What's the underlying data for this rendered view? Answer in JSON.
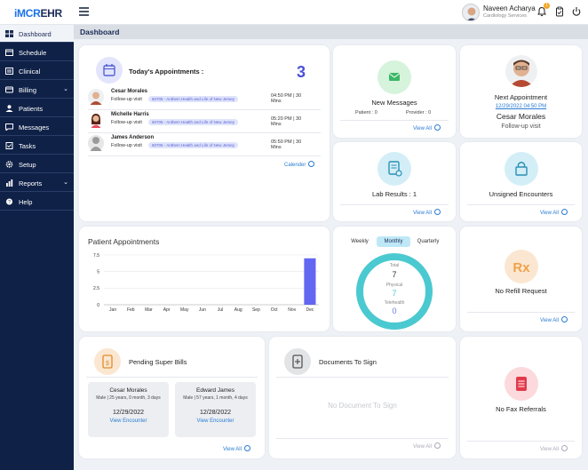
{
  "header": {
    "logo_prefix": "iMCR",
    "logo_suffix": "EHR",
    "user_name": "Naveen Acharya",
    "user_dept": "Cardiology Services",
    "notification_count": "1"
  },
  "sidebar": {
    "items": [
      {
        "label": "Dashboard",
        "icon": "dashboard-icon"
      },
      {
        "label": "Schedule",
        "icon": "calendar-icon"
      },
      {
        "label": "Clinical",
        "icon": "clinical-icon"
      },
      {
        "label": "Billing",
        "icon": "billing-icon"
      },
      {
        "label": "Patients",
        "icon": "patients-icon"
      },
      {
        "label": "Messages",
        "icon": "messages-icon"
      },
      {
        "label": "Tasks",
        "icon": "tasks-icon"
      },
      {
        "label": "Setup",
        "icon": "gear-icon"
      },
      {
        "label": "Reports",
        "icon": "reports-icon"
      },
      {
        "label": "Help",
        "icon": "help-icon"
      }
    ]
  },
  "breadcrumb": {
    "title": "Dashboard"
  },
  "todays_appointments": {
    "title": "Today's Appointments :",
    "count": "3",
    "rows": [
      {
        "name": "Cesar Morales",
        "visit": "Follow-up visit",
        "plan": "60705 - Anthem Health and Life of New Jersey",
        "time": "04:50 PM  |  30 Mins"
      },
      {
        "name": "Michelle Harris",
        "visit": "Follow-up visit",
        "plan": "60705 - Anthem Health and Life of New Jersey",
        "time": "05:20 PM  |  30 Mins"
      },
      {
        "name": "James Anderson",
        "visit": "Follow-up visit",
        "plan": "60705 - Anthem Health and Life of New Jersey",
        "time": "05:50 PM  |  30 Mins"
      }
    ],
    "calendar_link": "Calender"
  },
  "new_messages": {
    "title": "New Messages",
    "patient": "Patient : 0",
    "provider": "Provider : 0",
    "view_all": "View All"
  },
  "next_appointment": {
    "title": "Next Appointment",
    "datetime": "12/29/2022 04:50 PM",
    "name": "Cesar Morales",
    "visit": "Follow-up visit"
  },
  "lab_results": {
    "title": "Lab Results : 1",
    "view_all": "View All"
  },
  "unsigned_encounters": {
    "title": "Unsigned Encounters",
    "view_all": "View All"
  },
  "patient_appointments": {
    "title": "Patient Appointments"
  },
  "chart_data": {
    "type": "bar",
    "categories": [
      "Jan",
      "Feb",
      "Mar",
      "Apr",
      "May",
      "Jun",
      "Jul",
      "Aug",
      "Sep",
      "Oct",
      "Nov",
      "Dec"
    ],
    "values": [
      0,
      0,
      0,
      0,
      0,
      0,
      0,
      0,
      0,
      0,
      0,
      7
    ],
    "yticks": [
      "7.5",
      "5",
      "2.5",
      "0"
    ],
    "ylim": [
      0,
      7.5
    ],
    "title": "",
    "xlabel": "",
    "ylabel": "",
    "bar_color": "#6366f1",
    "grid": true
  },
  "visits_summary": {
    "tabs": [
      "Weekly",
      "Monthly",
      "Quarterly"
    ],
    "total_label": "Total",
    "total_value": "7",
    "physical_label": "Physical",
    "physical_value": "7",
    "telehealth_label": "Telehealth",
    "telehealth_value": "0",
    "ring_color": "#4bc9d0"
  },
  "refill": {
    "title": "No Refill Request",
    "view_all": "View All"
  },
  "pending_bills": {
    "title": "Pending Super Bills",
    "bills": [
      {
        "name": "Cesar Morales",
        "details": "Male | 25 years, 0 month, 3 days",
        "date": "12/29/2022",
        "link": "View Encounter"
      },
      {
        "name": "Edward James",
        "details": "Male | 57 years, 1 month, 4 days",
        "date": "12/28/2022",
        "link": "View Encounter"
      }
    ],
    "view_all": "View All"
  },
  "documents": {
    "title": "Documents To Sign",
    "empty": "No Document To Sign",
    "view_all": "View All"
  },
  "fax": {
    "title": "No Fax Referrals",
    "view_all": "View All"
  }
}
